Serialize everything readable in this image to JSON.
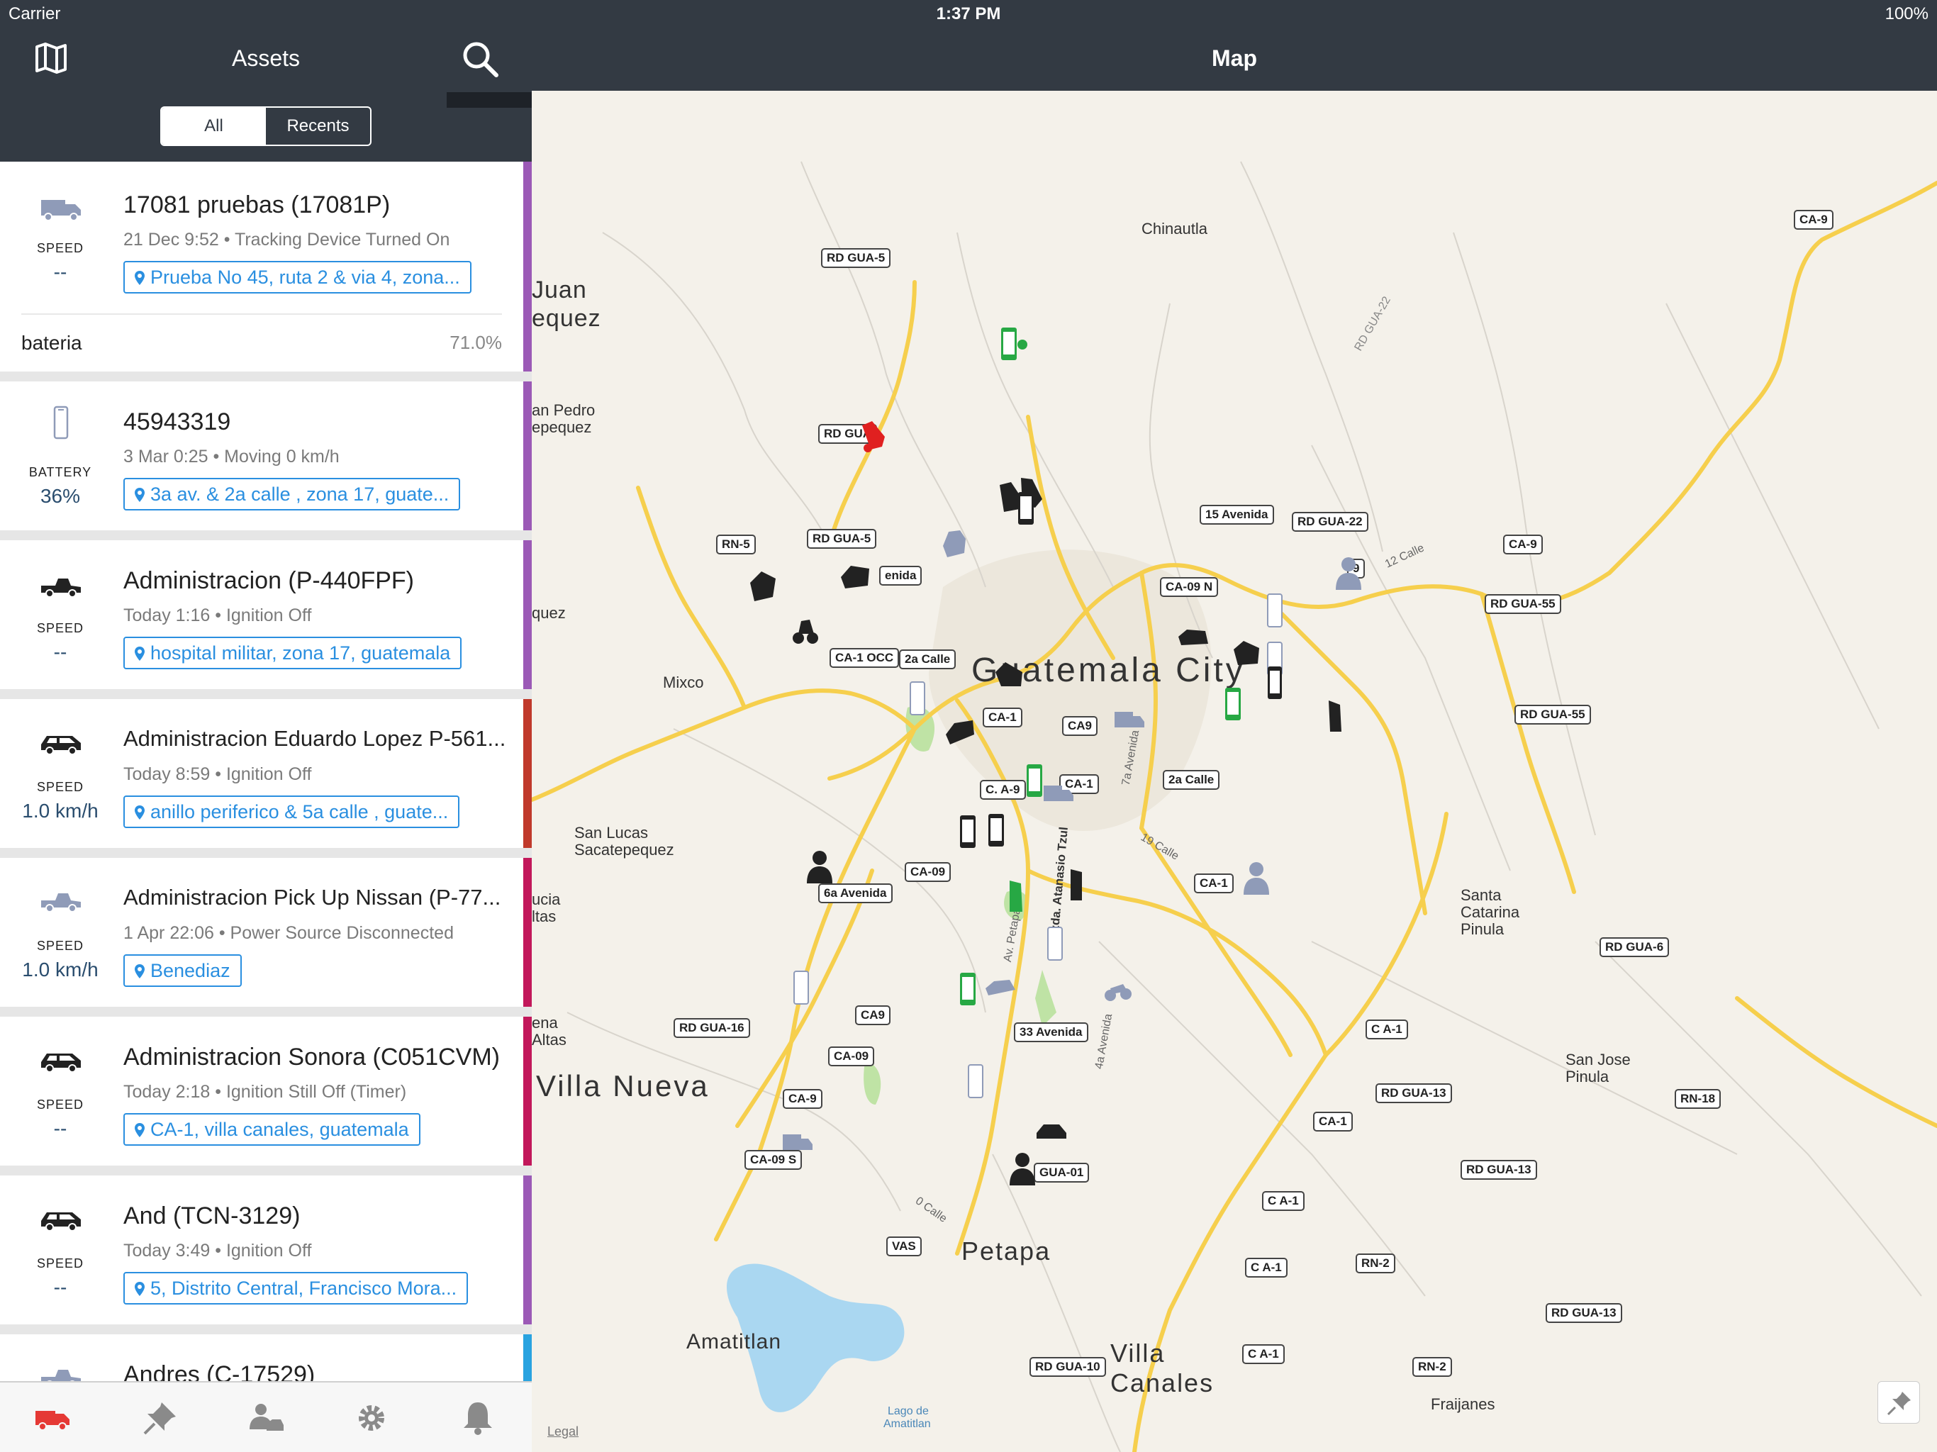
{
  "status_bar": {
    "carrier": "Carrier",
    "time": "1:37 PM",
    "battery": "100%"
  },
  "left_panel": {
    "title": "Assets",
    "segments": [
      "All",
      "Recents"
    ],
    "selected_segment": "All"
  },
  "assets": [
    {
      "name": "17081 pruebas (17081P)",
      "detail": "21 Dec 9:52 • Tracking Device Turned On",
      "address": "Prueba No 45, ruta 2 & via 4, zona...",
      "kind_label": "SPEED",
      "kind_value": "--",
      "icon": "truck-icon",
      "extra_label": "bateria",
      "extra_value": "71.0%",
      "accent": "#9b59b6"
    },
    {
      "name": "45943319",
      "detail": "3 Mar 0:25 • Moving 0 km/h",
      "address": "3a av.  & 2a calle , zona 17,  guate...",
      "kind_label": "BATTERY",
      "kind_value": "36%",
      "icon": "phone-icon",
      "accent": "#9b59b6"
    },
    {
      "name": "Administracion (P-440FPF)",
      "detail": "Today 1:16 • Ignition Off",
      "address": "hospital militar, zona 17,  guatemala",
      "kind_label": "SPEED",
      "kind_value": "--",
      "icon": "pickup-icon",
      "accent": "#9b59b6"
    },
    {
      "name": "Administracion Eduardo Lopez P-561...",
      "detail": "Today 8:59 • Ignition Off",
      "address": "anillo periferico & 5a calle , guate...",
      "kind_label": "SPEED",
      "kind_value": "1.0 km/h",
      "icon": "car-icon",
      "accent": "#c0392b"
    },
    {
      "name": "Administracion Pick Up Nissan (P-77...",
      "detail": "1 Apr 22:06 • Power Source Disconnected",
      "address": "Benediaz",
      "kind_label": "SPEED",
      "kind_value": "1.0 km/h",
      "icon": "pickup-icon",
      "accent": "#c2185b"
    },
    {
      "name": "Administracion Sonora (C051CVM)",
      "detail": "Today 2:18 • Ignition Still Off (Timer)",
      "address": "CA-1, villa canales,  guatemala",
      "kind_label": "SPEED",
      "kind_value": "--",
      "icon": "car-icon",
      "accent": "#c2185b"
    },
    {
      "name": "And (TCN-3129)",
      "detail": "Today 3:49 • Ignition Off",
      "address": "5, Distrito Central,  Francisco Mora...",
      "kind_label": "SPEED",
      "kind_value": "--",
      "icon": "car-icon",
      "accent": "#9b59b6"
    },
    {
      "name": "Andres (C-17529)",
      "detail": "",
      "address": "",
      "kind_label": "",
      "kind_value": "",
      "icon": "pickup-icon",
      "accent": "#29a3e0"
    }
  ],
  "map": {
    "title": "Map",
    "legal": "Legal",
    "places": [
      "Chinautla",
      "Juan",
      "equez",
      "an Pedro",
      "epequez",
      "quez",
      "Mixco",
      "Guatemala City",
      "San Lucas",
      "Sacatepequez",
      "ucia",
      "ltas",
      "ena",
      "Altas",
      "Villa Nueva",
      "Petapa",
      "Amatitlan",
      "Villa",
      "Canales",
      "Santa",
      "Catarina",
      "Pinula",
      "San Jose",
      "Pinula",
      "Fraijanes",
      "Lago de",
      "Amatitlan"
    ],
    "streets": [
      "12 Calle",
      "19 Calle",
      "7a Avenida",
      "4a Avenida",
      "Czda. Atanasio Tzul",
      "Av. Petapa",
      "0 Calle",
      "RD GUA-22"
    ],
    "shields": [
      "CA-9",
      "RD GUA-5",
      "15 Avenida",
      "RD GUA-22",
      "CA-9",
      "RD GUA-55",
      "RN-5",
      "RD GUA-5",
      "RD GUA",
      "enida",
      "9",
      "CA-09 N",
      "CA-1 OCC",
      "2a Calle",
      "CA-1",
      "CA9",
      "RD GUA-55",
      "C. A-9",
      "CA-1",
      "2a Calle",
      "CA-09",
      "6a Avenida",
      "CA-1",
      "RD GUA-6",
      "RD GUA-16",
      "CA9",
      "33 Avenida",
      "CA-09",
      "C A-1",
      "CA-9",
      "RD GUA-13",
      "RN-18",
      "CA-09 S",
      "CA-1",
      "GUA-01",
      "RD GUA-13",
      "C A-1",
      "VAS",
      "C A-1",
      "RN-2",
      "RD GUA-13",
      "C A-1",
      "RD GUA-10",
      "RN-2"
    ]
  }
}
